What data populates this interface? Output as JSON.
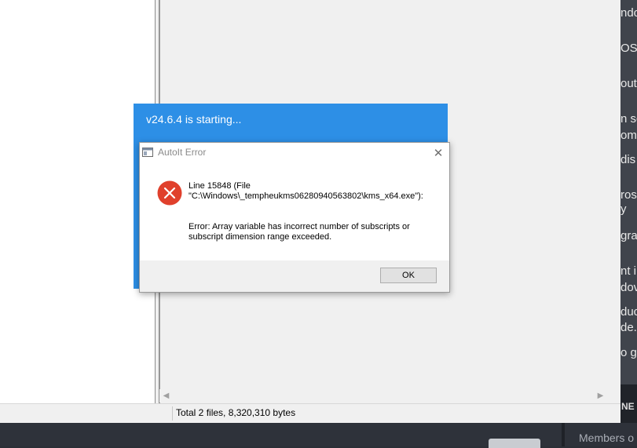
{
  "explorer": {
    "status_text": "Total 2 files, 8,320,310 bytes"
  },
  "splash": {
    "title": "v24.6.4 is starting..."
  },
  "dialog": {
    "title": "AutoIt Error",
    "line1": "Line 15848  (File",
    "line2": "\"C:\\Windows\\_tempheukms06280940563802\\kms_x64.exe\"):",
    "line3": "Error: Array variable has incorrect number of subscripts or",
    "line4": "subscript dimension range exceeded.",
    "ok_label": "OK",
    "close_glyph": "✕",
    "error_icon": "error-x-icon",
    "error_color": "#e0402c"
  },
  "background_web": {
    "lines": [
      "ndo",
      "OS",
      "out",
      "n sc",
      "om",
      "dis",
      "ros",
      "y",
      "gra",
      "nt i",
      "dov",
      "duc",
      "de.",
      "o g"
    ],
    "bold_fragment": "NE",
    "members_text": "Members o"
  },
  "colors": {
    "splash_blue": "#2d8fe6",
    "dark_bg": "#2e323a"
  }
}
